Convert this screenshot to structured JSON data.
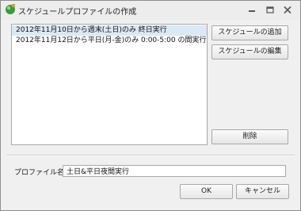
{
  "window": {
    "title": "スケジュールプロファイルの作成",
    "controls": {
      "minimize": "minimize-icon",
      "maximize": "maximize-icon",
      "close": "close-icon"
    }
  },
  "schedule_list": {
    "items": [
      "2012年11月10日から週末(土日)のみ 終日実行",
      "2012年11月12日から平日(月-金)のみ 0:00-5:00 の間実行"
    ],
    "selected_index": 0
  },
  "buttons": {
    "add": "スケジュールの追加",
    "edit": "スケジュールの編集",
    "delete": "削除",
    "ok": "OK",
    "cancel": "キャンセル"
  },
  "profile": {
    "label": "プロファイル名",
    "value": "土日&平日夜間実行"
  },
  "colors": {
    "selection": "#dbe8f6",
    "window_bg": "#f0f0f0",
    "app_icon": "#3a9a3a"
  }
}
